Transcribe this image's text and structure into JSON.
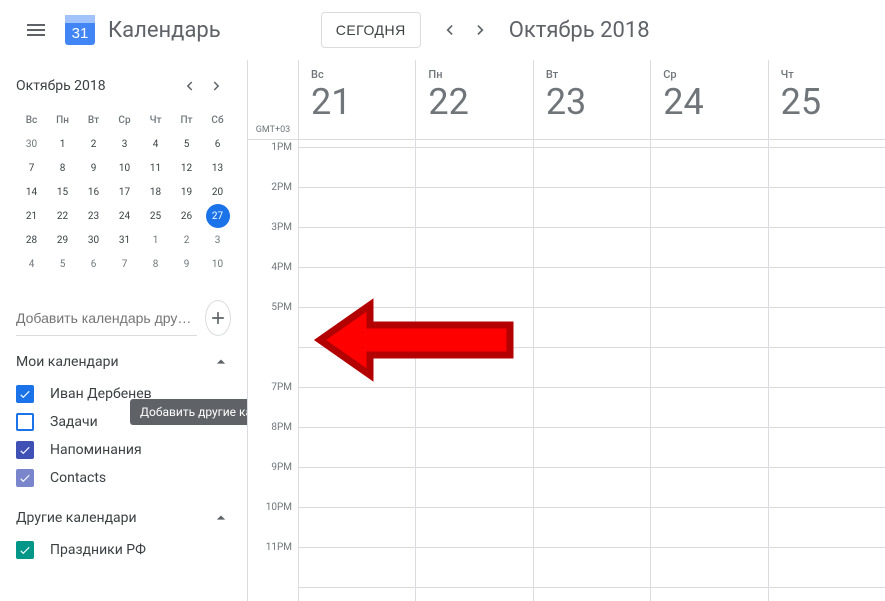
{
  "header": {
    "app_title": "Календарь",
    "today_label": "СЕГОДНЯ",
    "current_range": "Октябрь 2018",
    "logo_day": "31"
  },
  "mini_cal": {
    "month_label": "Октябрь 2018",
    "dow": [
      "Вс",
      "Пн",
      "Вт",
      "Ср",
      "Чт",
      "Пт",
      "Сб"
    ],
    "weeks": [
      [
        {
          "d": "30",
          "o": true
        },
        {
          "d": "1"
        },
        {
          "d": "2"
        },
        {
          "d": "3"
        },
        {
          "d": "4"
        },
        {
          "d": "5"
        },
        {
          "d": "6"
        }
      ],
      [
        {
          "d": "7"
        },
        {
          "d": "8"
        },
        {
          "d": "9"
        },
        {
          "d": "10"
        },
        {
          "d": "11"
        },
        {
          "d": "12"
        },
        {
          "d": "13"
        }
      ],
      [
        {
          "d": "14"
        },
        {
          "d": "15"
        },
        {
          "d": "16"
        },
        {
          "d": "17"
        },
        {
          "d": "18"
        },
        {
          "d": "19"
        },
        {
          "d": "20"
        }
      ],
      [
        {
          "d": "21"
        },
        {
          "d": "22"
        },
        {
          "d": "23"
        },
        {
          "d": "24"
        },
        {
          "d": "25"
        },
        {
          "d": "26"
        },
        {
          "d": "27",
          "t": true
        }
      ],
      [
        {
          "d": "28"
        },
        {
          "d": "29"
        },
        {
          "d": "30"
        },
        {
          "d": "31"
        },
        {
          "d": "1",
          "o": true
        },
        {
          "d": "2",
          "o": true
        },
        {
          "d": "3",
          "o": true
        }
      ],
      [
        {
          "d": "4",
          "o": true
        },
        {
          "d": "5",
          "o": true
        },
        {
          "d": "6",
          "o": true
        },
        {
          "d": "7",
          "o": true
        },
        {
          "d": "8",
          "o": true
        },
        {
          "d": "9",
          "o": true
        },
        {
          "d": "10",
          "o": true
        }
      ]
    ]
  },
  "add_calendar": {
    "placeholder": "Добавить календарь дру…",
    "tooltip": "Добавить другие календари"
  },
  "sections": {
    "my_label": "Мои календари",
    "other_label": "Другие календари"
  },
  "my_calendars": [
    {
      "label": "Иван Дербенев",
      "color": "#1a73e8",
      "checked": true
    },
    {
      "label": "Задачи",
      "color": "#1a73e8",
      "checked": false
    },
    {
      "label": "Напоминания",
      "color": "#3f51b5",
      "checked": true
    },
    {
      "label": "Contacts",
      "color": "#7986cb",
      "checked": true
    }
  ],
  "other_calendars": [
    {
      "label": "Праздники РФ",
      "color": "#009688",
      "checked": true
    }
  ],
  "grid": {
    "timezone": "GMT+03",
    "days": [
      {
        "dow": "Вс",
        "num": "21"
      },
      {
        "dow": "Пн",
        "num": "22"
      },
      {
        "dow": "Вт",
        "num": "23"
      },
      {
        "dow": "Ср",
        "num": "24"
      },
      {
        "dow": "Чт",
        "num": "25"
      }
    ],
    "hours": [
      "1PM",
      "2PM",
      "3PM",
      "4PM",
      "5PM",
      "",
      "7PM",
      "8PM",
      "9PM",
      "10PM",
      "11PM"
    ]
  }
}
